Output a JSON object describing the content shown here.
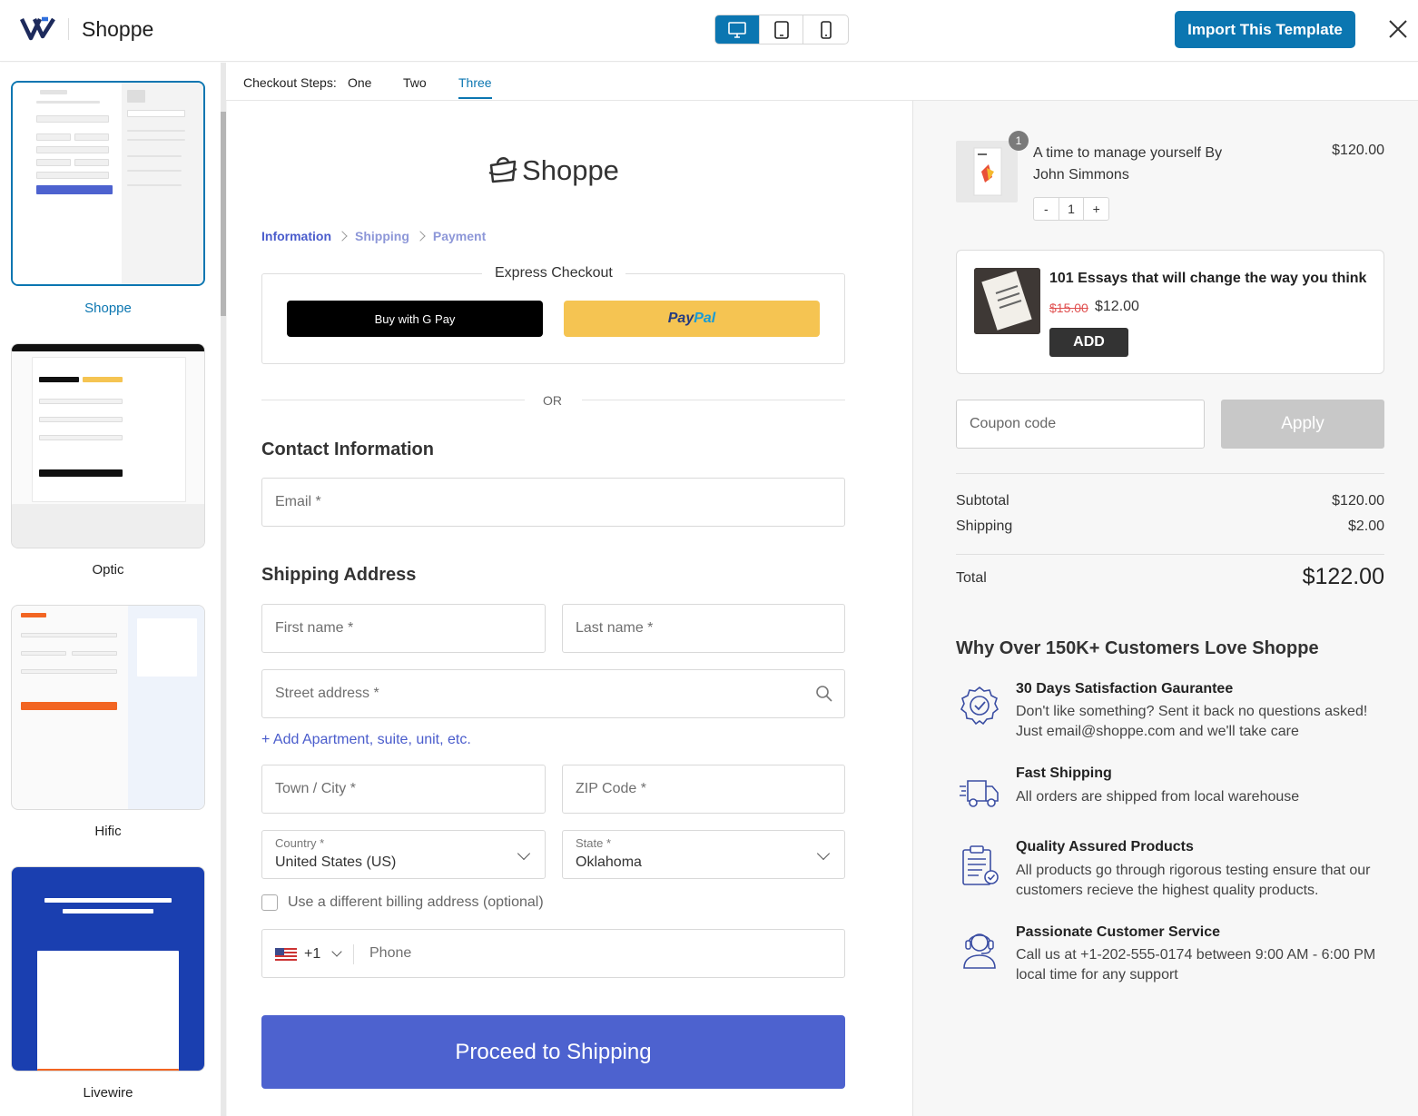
{
  "header": {
    "brand": "Shoppe",
    "import_label": "Import This Template"
  },
  "sidebar": {
    "templates": [
      {
        "name": "Shoppe"
      },
      {
        "name": "Optic"
      },
      {
        "name": "Hific"
      },
      {
        "name": "Livewire"
      }
    ]
  },
  "steps": {
    "label": "Checkout Steps:",
    "tabs": [
      "One",
      "Two",
      "Three"
    ],
    "active": "Three"
  },
  "checkout": {
    "logo_text": "Shoppe",
    "breadcrumbs": [
      "Information",
      "Shipping",
      "Payment"
    ],
    "express_title": "Express Checkout",
    "gpay_label": "Buy with G Pay",
    "paypal_pay": "Pay",
    "paypal_pal": "Pal",
    "or_text": "OR",
    "contact_title": "Contact Information",
    "email_placeholder": "Email *",
    "shipping_title": "Shipping Address",
    "first_name_placeholder": "First name *",
    "last_name_placeholder": "Last name *",
    "street_placeholder": "Street address *",
    "add_apt": "+ Add Apartment, suite, unit, etc.",
    "city_placeholder": "Town / City *",
    "zip_placeholder": "ZIP Code *",
    "country_label": "Country *",
    "country_value": "United States (US)",
    "state_label": "State *",
    "state_value": "Oklahoma",
    "billing_checkbox": "Use a different billing address (optional)",
    "phone_code": "+1",
    "phone_placeholder": "Phone",
    "proceed_label": "Proceed to Shipping"
  },
  "summary": {
    "item": {
      "qty_badge": "1",
      "name": "A time to manage yourself By John Simmons",
      "price": "$120.00",
      "qty": "1",
      "minus": "-",
      "plus": "+"
    },
    "upsell": {
      "title": "101 Essays that will change the way you think",
      "old_price": "$15.00",
      "new_price": "$12.00",
      "add_label": "ADD"
    },
    "coupon_placeholder": "Coupon code",
    "apply_label": "Apply",
    "subtotal_label": "Subtotal",
    "subtotal_value": "$120.00",
    "shipping_label": "Shipping",
    "shipping_value": "$2.00",
    "total_label": "Total",
    "total_value": "$122.00"
  },
  "why": {
    "title": "Why Over 150K+ Customers Love Shoppe",
    "features": [
      {
        "title": "30 Days Satisfaction Gaurantee",
        "desc": "Don't like something? Sent it back no questions asked! Just email@shoppe.com and we'll take care",
        "icon": "badge-check-icon"
      },
      {
        "title": "Fast Shipping",
        "desc": "All orders are shipped from local warehouse",
        "icon": "truck-icon"
      },
      {
        "title": "Quality Assured Products",
        "desc": "All products go through rigorous testing ensure that our customers recieve the highest quality products.",
        "icon": "clipboard-check-icon"
      },
      {
        "title": "Passionate Customer Service",
        "desc": "Call us at +1-202-555-0174 between 9:00 AM - 6:00 PM local time for any support",
        "icon": "headset-icon"
      }
    ]
  },
  "colors": {
    "accent": "#0b76b1",
    "primary_button": "#4d62cf",
    "link": "#4a5ccc",
    "paypal": "#f5c452"
  }
}
